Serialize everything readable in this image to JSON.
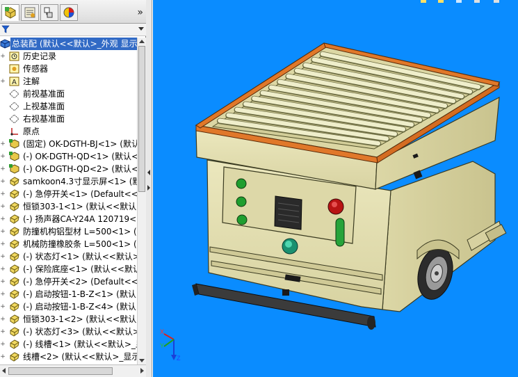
{
  "tabs": [
    {
      "name": "feature-manager",
      "icon": "feature-tree-icon"
    },
    {
      "name": "property-manager",
      "icon": "property-icon"
    },
    {
      "name": "configuration-manager",
      "icon": "configuration-icon"
    },
    {
      "name": "display-manager",
      "icon": "appearance-icon"
    }
  ],
  "more_tabs_glyph": "»",
  "tree": {
    "root": "总装配  (默认<<默认>_外观 显示",
    "items": [
      {
        "label": "历史记录",
        "icon": "history-icon",
        "expander": "+"
      },
      {
        "label": "传感器",
        "icon": "sensor-icon",
        "expander": ""
      },
      {
        "label": "注解",
        "icon": "annotation-icon",
        "expander": "+"
      },
      {
        "label": "前视基准面",
        "icon": "plane-icon",
        "expander": ""
      },
      {
        "label": "上视基准面",
        "icon": "plane-icon",
        "expander": ""
      },
      {
        "label": "右视基准面",
        "icon": "plane-icon",
        "expander": ""
      },
      {
        "label": "原点",
        "icon": "origin-icon",
        "expander": ""
      },
      {
        "label": "(固定) OK-DGTH-BJ<1> (默认",
        "icon": "subassembly-icon",
        "expander": "+"
      },
      {
        "label": "(-) OK-DGTH-QD<1> (默认<",
        "icon": "subassembly-icon",
        "expander": "+"
      },
      {
        "label": "(-) OK-DGTH-QD<2> (默认<",
        "icon": "subassembly-icon",
        "expander": "+"
      },
      {
        "label": "samkoon4.3寸显示屏<1> (默认",
        "icon": "part-icon",
        "expander": "+"
      },
      {
        "label": "(-) 急停开关<1> (Default<<D",
        "icon": "part-icon",
        "expander": "+"
      },
      {
        "label": "恒锁303-1<1> (默认<<默认>",
        "icon": "part-icon",
        "expander": "+"
      },
      {
        "label": "(-) 扬声器CA-Y24A 120719<",
        "icon": "part-icon",
        "expander": "+"
      },
      {
        "label": "防撞机构铝型材 L=500<1> (默",
        "icon": "part-icon",
        "expander": "+"
      },
      {
        "label": "机械防撞橡胶条 L=500<1> (默",
        "icon": "part-icon",
        "expander": "+"
      },
      {
        "label": "(-) 状态灯<1> (默认<<默认>",
        "icon": "part-icon",
        "expander": "+"
      },
      {
        "label": "(-) 保险底座<1> (默认<<默认",
        "icon": "part-icon",
        "expander": "+"
      },
      {
        "label": "(-) 急停开关<2> (Default<<D",
        "icon": "part-icon",
        "expander": "+"
      },
      {
        "label": "(-) 启动按钮-1-B-Z<1> (默认",
        "icon": "part-icon",
        "expander": "+"
      },
      {
        "label": "(-) 启动按钮-1-B-Z<4> (默认",
        "icon": "part-icon",
        "expander": "+"
      },
      {
        "label": "恒锁303-1<2> (默认<<默认>",
        "icon": "part-icon",
        "expander": "+"
      },
      {
        "label": "(-) 状态灯<3> (默认<<默认>",
        "icon": "part-icon",
        "expander": "+"
      },
      {
        "label": "(-) 线槽<1> (默认<<默认>_显",
        "icon": "part-icon",
        "expander": "+"
      },
      {
        "label": "线槽<2> (默认<<默认>_显示",
        "icon": "part-icon",
        "expander": "+"
      }
    ]
  },
  "colors": {
    "viewport_bg": "#0a8cff",
    "selection": "#316ac5",
    "body": "#e6e2b4",
    "trim": "#e0782a",
    "roller": "#efeecb"
  },
  "triad_labels": {
    "x": "X",
    "y": "Y",
    "z": "Z"
  }
}
